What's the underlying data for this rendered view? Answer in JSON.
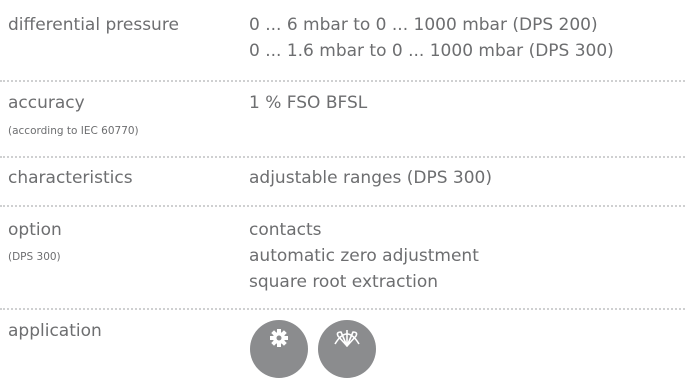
{
  "specs": [
    {
      "label": "differential pressure",
      "sublabel": "",
      "values": [
        "0 ... 6 mbar to 0 ... 1000 mbar (DPS 200)",
        "0 ... 1.6 mbar to 0 ... 1000 mbar (DPS 300)"
      ]
    },
    {
      "label": "accuracy",
      "sublabel": "(according to  IEC 60770)",
      "values": [
        "1 % FSO BFSL"
      ]
    },
    {
      "label": "characteristics",
      "sublabel": "",
      "values": [
        "adjustable ranges (DPS 300)"
      ]
    },
    {
      "label": "option",
      "sublabel": "(DPS 300)",
      "values": [
        "contacts",
        "automatic zero adjustment",
        "square root extraction"
      ]
    },
    {
      "label": "application",
      "sublabel": "",
      "values": []
    }
  ],
  "application_icons": [
    {
      "icon": "gear-icon",
      "color": "#8b8c8e"
    },
    {
      "icon": "fan-icon",
      "color": "#8b8c8e"
    }
  ]
}
